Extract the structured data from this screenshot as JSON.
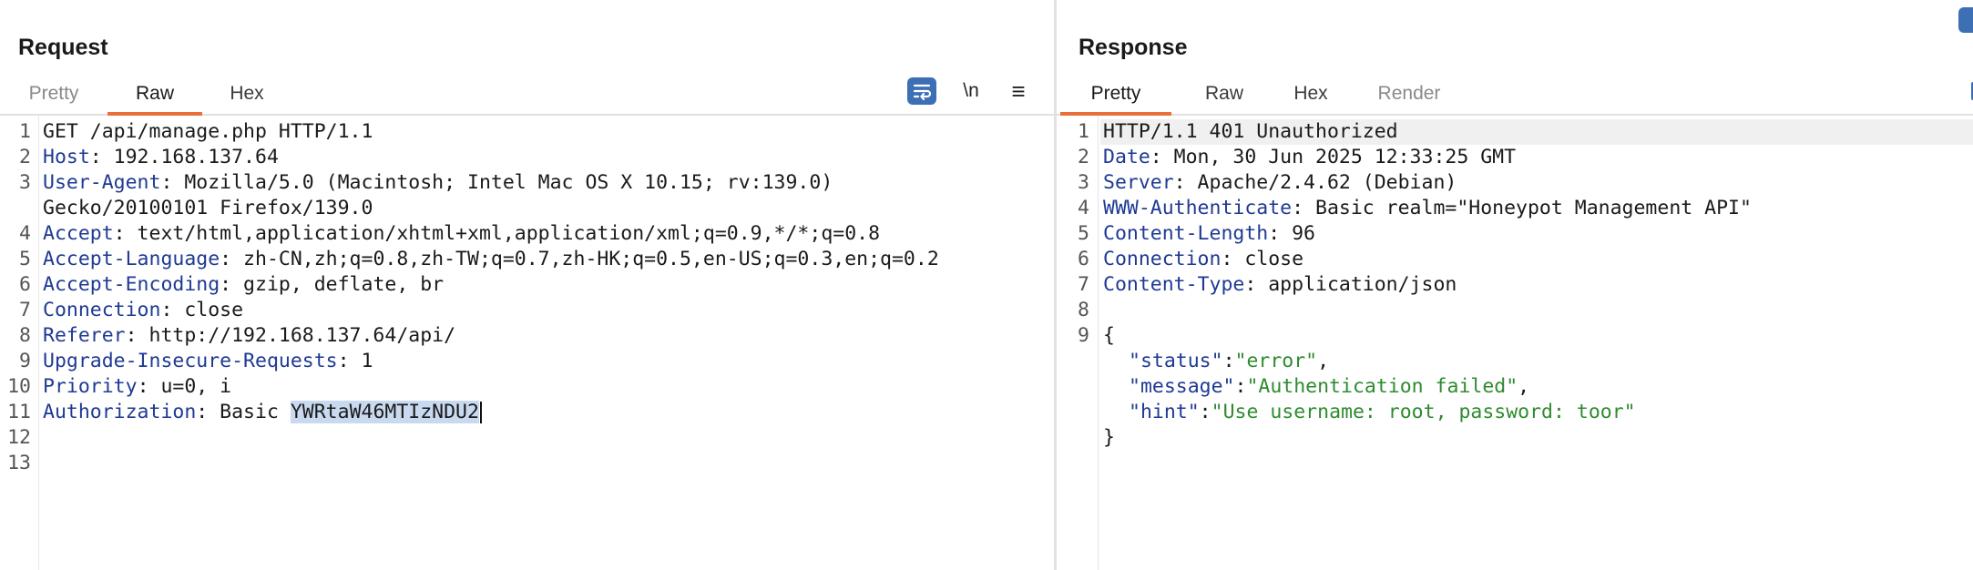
{
  "request": {
    "title": "Request",
    "tabs": [
      {
        "label": "Pretty"
      },
      {
        "label": "Raw"
      },
      {
        "label": "Hex"
      }
    ],
    "active_tab": "Raw",
    "toolbar": {
      "wrap_icon": "word-wrap-icon",
      "newline_label": "\\n",
      "menu_icon": "hamburger-menu-icon",
      "menu_glyph": "≡"
    },
    "lines": [
      {
        "num": "1",
        "name": "",
        "text": "GET /api/manage.php HTTP/1.1"
      },
      {
        "num": "2",
        "name": "Host",
        "text": ": 192.168.137.64"
      },
      {
        "num": "3",
        "name": "User-Agent",
        "text": ": Mozilla/5.0 (Macintosh; Intel Mac OS X 10.15; rv:139.0)"
      },
      {
        "num": "",
        "name": "",
        "text": "Gecko/20100101 Firefox/139.0"
      },
      {
        "num": "4",
        "name": "Accept",
        "text": ": text/html,application/xhtml+xml,application/xml;q=0.9,*/*;q=0.8"
      },
      {
        "num": "5",
        "name": "Accept-Language",
        "text": ": zh-CN,zh;q=0.8,zh-TW;q=0.7,zh-HK;q=0.5,en-US;q=0.3,en;q=0.2"
      },
      {
        "num": "6",
        "name": "Accept-Encoding",
        "text": ": gzip, deflate, br"
      },
      {
        "num": "7",
        "name": "Connection",
        "text": ": close"
      },
      {
        "num": "8",
        "name": "Referer",
        "text": ": http://192.168.137.64/api/"
      },
      {
        "num": "9",
        "name": "Upgrade-Insecure-Requests",
        "text": ": 1"
      },
      {
        "num": "10",
        "name": "Priority",
        "text": ": u=0, i"
      },
      {
        "num": "11",
        "name": "Authorization",
        "text": ": Basic ",
        "selected": "YWRtaW46MTIzNDU2"
      },
      {
        "num": "12",
        "name": "",
        "text": ""
      },
      {
        "num": "13",
        "name": "",
        "text": ""
      }
    ]
  },
  "response": {
    "title": "Response",
    "tabs": [
      {
        "label": "Pretty"
      },
      {
        "label": "Raw"
      },
      {
        "label": "Hex"
      },
      {
        "label": "Render"
      }
    ],
    "active_tab": "Pretty",
    "lines": [
      {
        "num": "1",
        "name": "",
        "text": "HTTP/1.1 401 Unauthorized"
      },
      {
        "num": "2",
        "name": "Date",
        "text": ": Mon, 30 Jun 2025 12:33:25 GMT"
      },
      {
        "num": "3",
        "name": "Server",
        "text": ": Apache/2.4.62 (Debian)"
      },
      {
        "num": "4",
        "name": "WWW-Authenticate",
        "text": ": Basic realm=\"Honeypot Management API\""
      },
      {
        "num": "5",
        "name": "Content-Length",
        "text": ": 96"
      },
      {
        "num": "6",
        "name": "Connection",
        "text": ": close"
      },
      {
        "num": "7",
        "name": "Content-Type",
        "text": ": application/json"
      },
      {
        "num": "8",
        "name": "",
        "text": ""
      },
      {
        "num": "9",
        "name": "",
        "text": "{"
      }
    ],
    "json_lines": [
      {
        "key": "\"status\"",
        "sep": ":",
        "value": "\"error\"",
        "tail": ","
      },
      {
        "key": "\"message\"",
        "sep": ":",
        "value": "\"Authentication failed\"",
        "tail": ","
      },
      {
        "key": "\"hint\"",
        "sep": ":",
        "value": "\"Use username: root, password: toor\"",
        "tail": ""
      }
    ],
    "closing": "}"
  },
  "colors": {
    "accent_tab": "#e8703a",
    "header_name": "#1f3a93",
    "json_string": "#2e8b2e",
    "selection": "#c9d9ef",
    "button_blue": "#3d6fb5"
  }
}
